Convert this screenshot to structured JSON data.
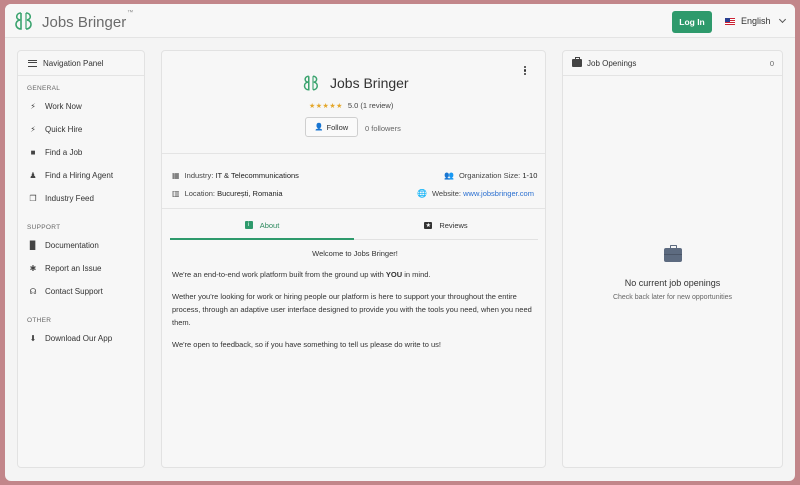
{
  "header": {
    "logo_text": "Jobs Bringer",
    "logo_tm": "™",
    "login_label": "Log In",
    "language": "English"
  },
  "sidebar": {
    "title": "Navigation Panel",
    "sections": [
      {
        "label": "GENERAL",
        "items": [
          {
            "label": "Work Now",
            "icon": "bolt-icon"
          },
          {
            "label": "Quick Hire",
            "icon": "bolt-icon"
          },
          {
            "label": "Find a Job",
            "icon": "briefcase-icon"
          },
          {
            "label": "Find a Hiring Agent",
            "icon": "person-icon"
          },
          {
            "label": "Industry Feed",
            "icon": "feed-icon"
          }
        ]
      },
      {
        "label": "SUPPORT",
        "items": [
          {
            "label": "Documentation",
            "icon": "book-icon"
          },
          {
            "label": "Report an Issue",
            "icon": "bug-icon"
          },
          {
            "label": "Contact Support",
            "icon": "headset-icon"
          }
        ]
      },
      {
        "label": "OTHER",
        "items": [
          {
            "label": "Download Our App",
            "icon": "download-icon"
          }
        ]
      }
    ]
  },
  "company": {
    "name": "Jobs Bringer",
    "stars": "★★★★★",
    "rating_text": "5.0 (1 review)",
    "rating_value": 5.0,
    "follow_label": "Follow",
    "followers_text": "0 followers",
    "industry_label": "Industry:",
    "industry_value": "IT & Telecommunications",
    "org_size_label": "Organization Size:",
    "org_size_value": "1-10",
    "location_label": "Location:",
    "location_value": "București, Romania",
    "website_label": "Website:",
    "website_value": "www.jobsbringer.com"
  },
  "tabs": {
    "about_label": "About",
    "reviews_label": "Reviews",
    "active": "about"
  },
  "about": {
    "welcome": "Welcome to Jobs Bringer!",
    "p1_before": "We're an end-to-end work platform built from the ground up with ",
    "p1_bold": "YOU",
    "p1_after": " in mind.",
    "p2": "Wether you're looking for work or hiring people our platform is here to support your throughout the entire process, through an adaptive user interface designed to provide you with the tools you need, when you need them.",
    "p3": "We're open to feedback, so if you have something to tell us please do write to us!"
  },
  "jobs": {
    "title": "Job Openings",
    "count": "0",
    "empty_title": "No current job openings",
    "empty_sub": "Check back later for new opportunities"
  },
  "colors": {
    "accent": "#2e9a6c",
    "star": "#e4a72c",
    "link": "#2a6fd0"
  }
}
